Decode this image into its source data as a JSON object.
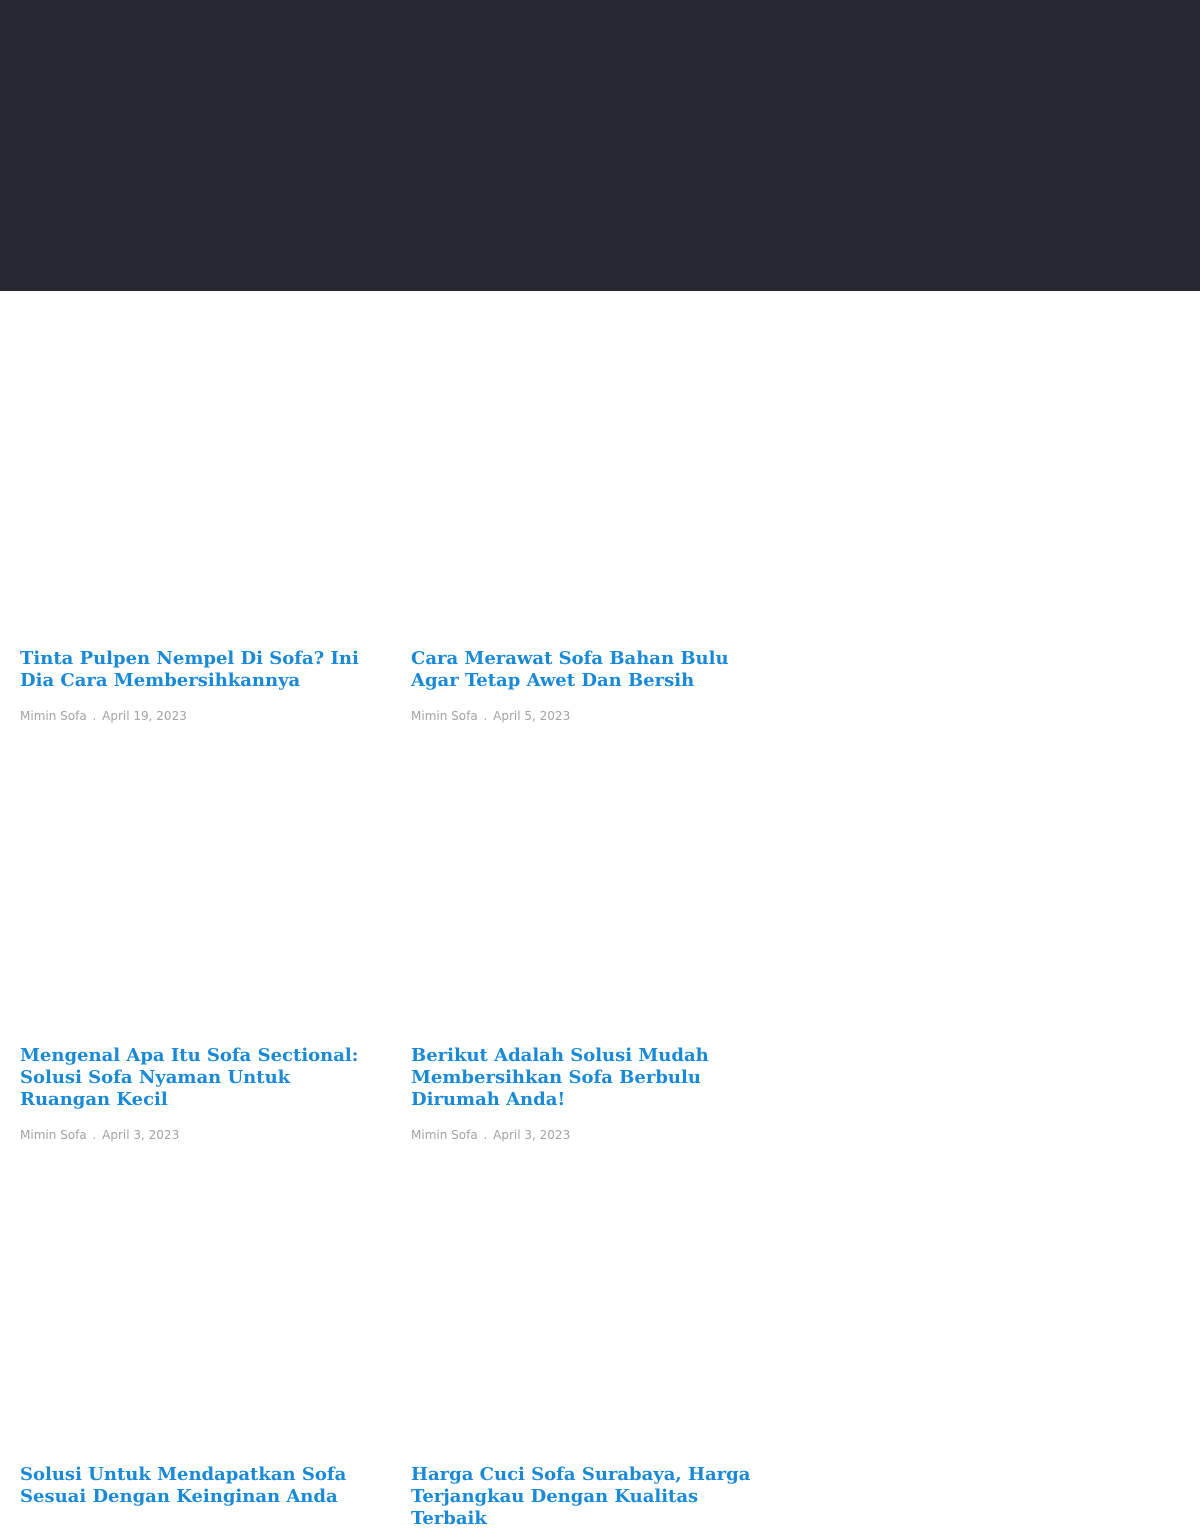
{
  "colors": {
    "hero_background": "#282832",
    "page_background": "#ffffff",
    "title_link": "#1a8ad6",
    "meta_text": "#a3a3a3"
  },
  "posts": [
    {
      "title": "Tinta Pulpen Nempel Di Sofa? Ini Dia Cara Membersihkannya",
      "author": "Mimin Sofa",
      "separator": ".",
      "date": "April 19, 2023"
    },
    {
      "title": "Cara Merawat Sofa Bahan Bulu Agar Tetap Awet Dan Bersih",
      "author": "Mimin Sofa",
      "separator": ".",
      "date": "April 5, 2023"
    },
    {
      "title": "Mengenal Apa Itu Sofa Sectional: Solusi Sofa Nyaman Untuk Ruangan Kecil",
      "author": "Mimin Sofa",
      "separator": ".",
      "date": "April 3, 2023"
    },
    {
      "title": "Berikut Adalah Solusi Mudah Membersihkan Sofa Berbulu Dirumah Anda!",
      "author": "Mimin Sofa",
      "separator": ".",
      "date": "April 3, 2023"
    },
    {
      "title": "Solusi Untuk Mendapatkan Sofa Sesuai Dengan Keinginan Anda",
      "author": "",
      "separator": "",
      "date": ""
    },
    {
      "title": "Harga Cuci Sofa Surabaya, Harga Terjangkau Dengan Kualitas Terbaik",
      "author": "",
      "separator": "",
      "date": ""
    }
  ]
}
